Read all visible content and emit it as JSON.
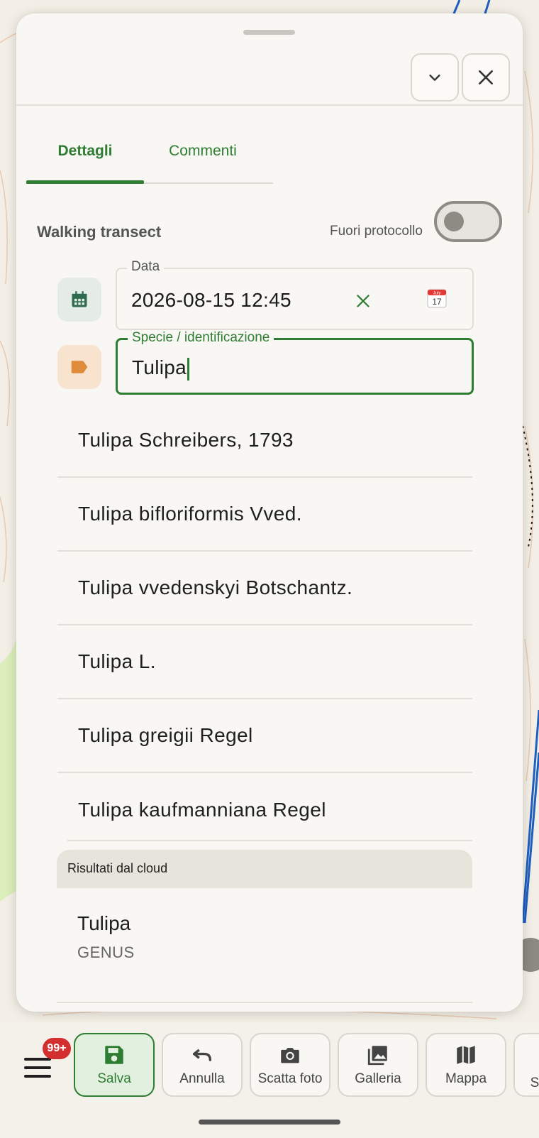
{
  "header": {
    "collapse_icon": "chevron-down-icon",
    "close_icon": "close-icon"
  },
  "tabs": [
    {
      "label": "Dettagli",
      "active": true
    },
    {
      "label": "Commenti",
      "active": false
    }
  ],
  "form": {
    "section_title": "Walking transect",
    "toggle_label": "Fuori protocollo",
    "toggle_on": false,
    "date_label": "Data",
    "date_value": "2026-08-15 12:45",
    "calendar_glyph_month": "July",
    "calendar_glyph_day": "17",
    "species_label": "Specie / identificazione",
    "species_value": "Tulipa"
  },
  "suggestions": [
    "Tulipa Schreibers, 1793",
    "Tulipa bifloriformis Vved.",
    "Tulipa vvedenskyi Botschantz.",
    "Tulipa L.",
    "Tulipa greigii Regel",
    "Tulipa kaufmanniana Regel"
  ],
  "cloud": {
    "header": "Risultati dal cloud",
    "results": [
      {
        "name": "Tulipa",
        "rank": "GENUS"
      }
    ]
  },
  "bottom_bar": {
    "badge": "99+",
    "actions": [
      {
        "label": "Salva",
        "icon": "save-icon"
      },
      {
        "label": "Annulla",
        "icon": "undo-icon"
      },
      {
        "label": "Scatta foto",
        "icon": "camera-icon"
      },
      {
        "label": "Galleria",
        "icon": "gallery-icon"
      },
      {
        "label": "Mappa",
        "icon": "map-icon"
      },
      {
        "label": "S",
        "icon": "more-icon"
      }
    ]
  },
  "colors": {
    "accent": "#2e7d32",
    "badge": "#d32f2f",
    "tag_icon": "#e08a3c"
  }
}
